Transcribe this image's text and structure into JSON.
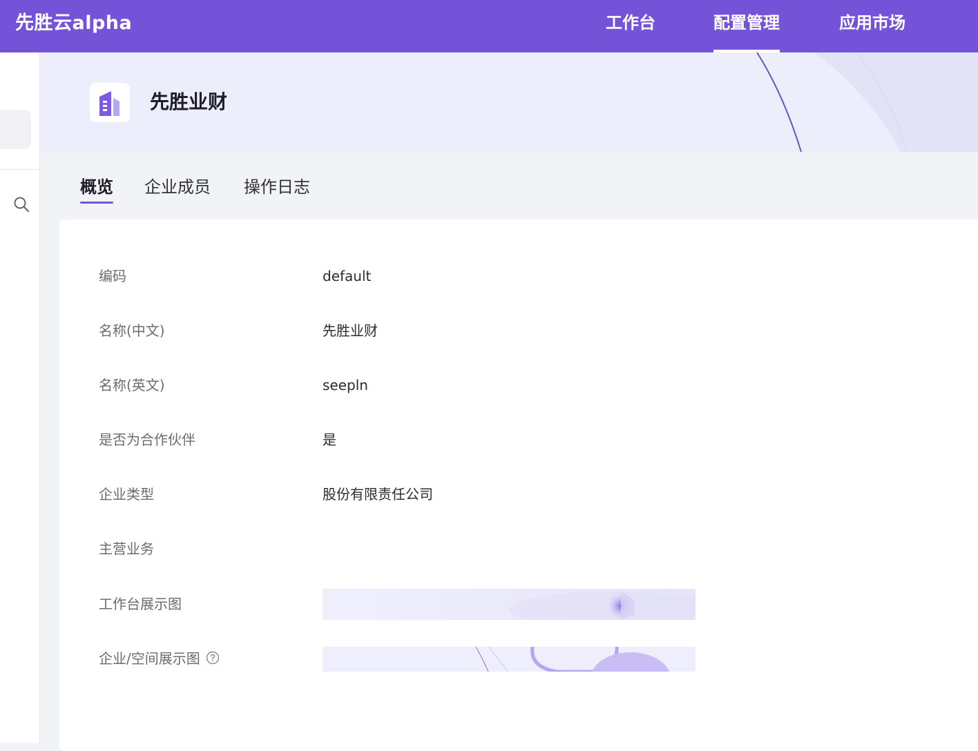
{
  "topbar": {
    "brand": "先胜云alpha",
    "nav": [
      "工作台",
      "配置管理",
      "应用市场"
    ],
    "active_nav": "配置管理",
    "bg_color": "#7553d9"
  },
  "header": {
    "title": "先胜业财",
    "icon": "building-icon"
  },
  "tabs": {
    "items": [
      "概览",
      "企业成员",
      "操作日志"
    ],
    "active": "概览"
  },
  "details": {
    "code_label": "编码",
    "code_value": "default",
    "name_cn_label": "名称(中文)",
    "name_cn_value": "先胜业财",
    "name_en_label": "名称(英文)",
    "name_en_value": "seepln",
    "partner_label": "是否为合作伙伴",
    "partner_value": "是",
    "type_label": "企业类型",
    "type_value": "股份有限责任公司",
    "business_label": "主营业务",
    "business_value": "",
    "workbench_image_label": "工作台展示图",
    "space_image_label": "企业/空间展示图"
  },
  "icons": {
    "sidebar_search": "search-icon",
    "help": "help-circle-icon"
  }
}
